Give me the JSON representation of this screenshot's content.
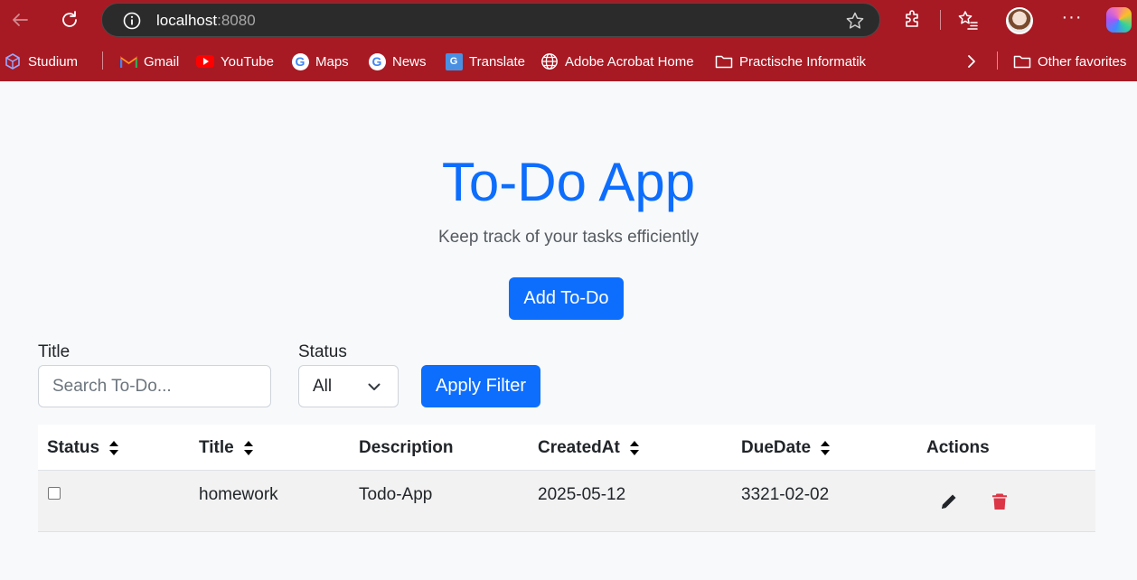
{
  "browser": {
    "url_host": "localhost",
    "url_port": ":8080",
    "bookmarks": [
      {
        "label": "Studium",
        "icon": "studium-icon"
      },
      {
        "label": "Gmail",
        "icon": "gmail-icon"
      },
      {
        "label": "YouTube",
        "icon": "youtube-icon"
      },
      {
        "label": "Maps",
        "icon": "google-icon"
      },
      {
        "label": "News",
        "icon": "google-icon"
      },
      {
        "label": "Translate",
        "icon": "translate-icon"
      },
      {
        "label": "Adobe Acrobat Home",
        "icon": "globe-icon"
      },
      {
        "label": "Practische Informatik",
        "icon": "folder-icon"
      }
    ],
    "other_favorites": "Other favorites",
    "google_letter": "G",
    "translate_letter": "G"
  },
  "app": {
    "title": "To-Do App",
    "subtitle": "Keep track of your tasks efficiently",
    "add_button": "Add To-Do"
  },
  "filters": {
    "title_label": "Title",
    "title_placeholder": "Search To-Do...",
    "status_label": "Status",
    "status_value": "All",
    "apply_button": "Apply Filter"
  },
  "table": {
    "columns": [
      "Status",
      "Title",
      "Description",
      "CreatedAt",
      "DueDate",
      "Actions"
    ],
    "rows": [
      {
        "done": false,
        "title": "homework",
        "description": "Todo-App",
        "created_at": "2025-05-12",
        "due_date": "3321-02-02"
      }
    ]
  },
  "colors": {
    "chrome": "#a71a24",
    "primary": "#0d6efd",
    "danger": "#dc3545"
  }
}
